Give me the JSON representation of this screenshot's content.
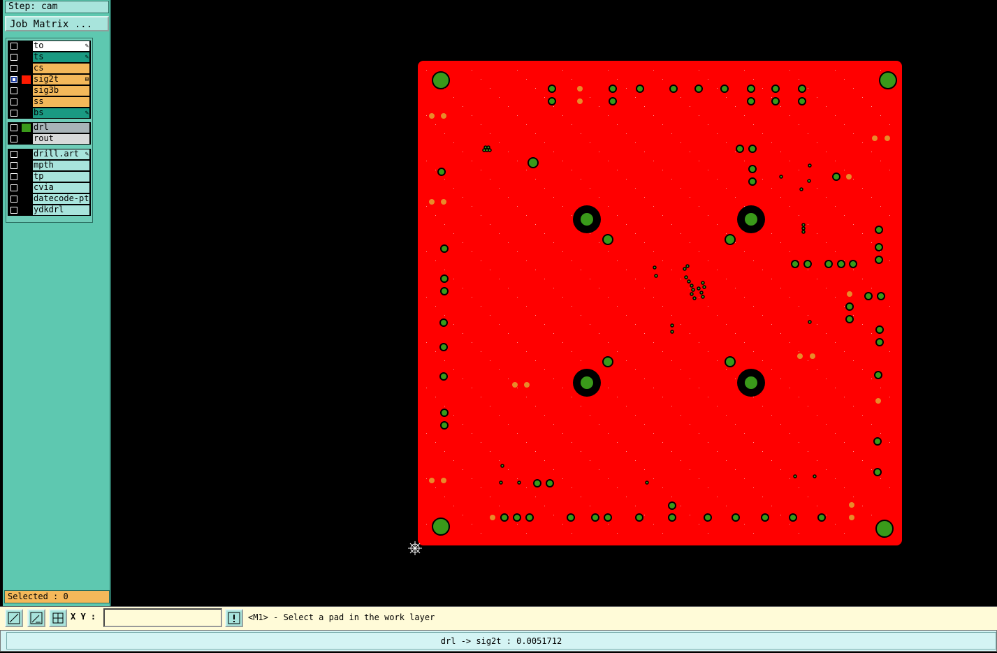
{
  "step": {
    "label": "Step: cam"
  },
  "job_matrix": {
    "label": "Job Matrix ..."
  },
  "layer_groups": [
    [
      {
        "name": "to",
        "bg": "#ffffff",
        "swatch": "#000000",
        "checked": false,
        "mark": "pencil-icon"
      },
      {
        "name": "ts",
        "bg": "#1a9a82",
        "swatch": "#000000",
        "checked": false,
        "mark": "pencil-icon"
      },
      {
        "name": "cs",
        "bg": "#f4b85a",
        "swatch": "#000000",
        "checked": false,
        "mark": ""
      },
      {
        "name": "sig2t",
        "bg": "#f4b85a",
        "swatch": "#ff1a00",
        "checked": true,
        "mark": "grid-icon"
      },
      {
        "name": "sig3b",
        "bg": "#f4b85a",
        "swatch": "#000000",
        "checked": false,
        "mark": ""
      },
      {
        "name": "ss",
        "bg": "#f4b85a",
        "swatch": "#000000",
        "checked": false,
        "mark": ""
      },
      {
        "name": "bs",
        "bg": "#1a9a82",
        "swatch": "#000000",
        "checked": false,
        "mark": "pencil-icon"
      }
    ],
    [
      {
        "name": "drl",
        "bg": "#a8b4b8",
        "swatch": "#3a9a1a",
        "checked": false,
        "mark": ""
      },
      {
        "name": "rout",
        "bg": "#d8dada",
        "swatch": "#000000",
        "checked": false,
        "mark": ""
      }
    ],
    [
      {
        "name": "drill.art",
        "bg": "#a8e4dc",
        "swatch": "#000000",
        "checked": false,
        "mark": "pencil-icon"
      },
      {
        "name": "mpth",
        "bg": "#a8e4dc",
        "swatch": "#000000",
        "checked": false,
        "mark": ""
      },
      {
        "name": "tp",
        "bg": "#a8e4dc",
        "swatch": "#000000",
        "checked": false,
        "mark": ""
      },
      {
        "name": "cvia",
        "bg": "#a8e4dc",
        "swatch": "#000000",
        "checked": false,
        "mark": ""
      },
      {
        "name": "datecode-ptc",
        "bg": "#a8e4dc",
        "swatch": "#000000",
        "checked": false,
        "mark": ""
      },
      {
        "name": "ydkdrl",
        "bg": "#a8e4dc",
        "swatch": "#000000",
        "checked": false,
        "mark": ""
      }
    ]
  ],
  "selected": {
    "label": "Selected : 0"
  },
  "toolbar": {
    "xy_label": "X Y :",
    "xy_value": "",
    "prompt": "<M1> - Select a pad in the work layer"
  },
  "status": {
    "text": "drl -> sig2t : 0.0051712"
  },
  "colors": {
    "board": "#ff0000",
    "pad": "#3a9a1a",
    "pad_orange": "#e88a2a",
    "sidebar": "#5ec8b0"
  }
}
